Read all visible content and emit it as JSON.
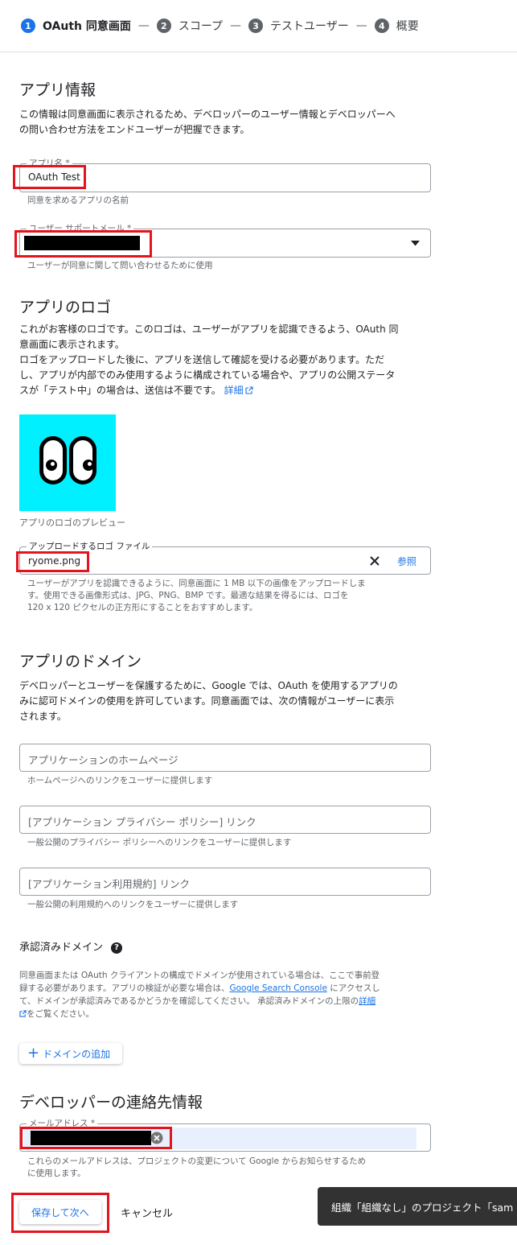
{
  "stepper": {
    "steps": [
      {
        "num": "1",
        "label": "OAuth 同意画面"
      },
      {
        "num": "2",
        "label": "スコープ"
      },
      {
        "num": "3",
        "label": "テストユーザー"
      },
      {
        "num": "4",
        "label": "概要"
      }
    ],
    "separator": "—"
  },
  "app_info": {
    "title": "アプリ情報",
    "description_lines": [
      "この情報は同意画面に表示されるため、デベロッパーのユーザー情報とデベロッパーへ",
      "の問い合わせ方法をエンドユーザーが把握できます。"
    ],
    "app_name": {
      "label": "アプリ名 *",
      "value": "OAuth Test",
      "hint": "同意を求めるアプリの名前"
    },
    "support_email": {
      "label": "ユーザー サポートメール *",
      "hint": "ユーザーが同意に関して問い合わせるために使用"
    }
  },
  "app_logo": {
    "title": "アプリのロゴ",
    "description_lines": [
      "これがお客様のロゴです。このロゴは、ユーザーがアプリを認識できるよう、OAuth 同",
      "意画面に表示されます。",
      "ロゴをアップロードした後に、アプリを送信して確認を受ける必要があります。ただ",
      "し、アプリが内部でのみ使用するように構成されている場合や、アプリの公開ステータ",
      "スが「テスト中」の場合は、送信は不要です。"
    ],
    "details_link": "詳細",
    "preview_caption": "アプリのロゴのプレビュー",
    "file_field": {
      "label": "アップロードするロゴ ファイル",
      "value": "ryome.png",
      "browse_label": "参照"
    },
    "file_hint_lines": [
      "ユーザーがアプリを認識できるように、同意画面に 1 MB 以下の画像をアップロードしま",
      "す。使用できる画像形式は、JPG、PNG、BMP です。最適な結果を得るには、ロゴを",
      "120 x 120 ピクセルの正方形にすることをおすすめします。"
    ]
  },
  "app_domain": {
    "title": "アプリのドメイン",
    "description_lines": [
      "デベロッパーとユーザーを保護するために、Google では、OAuth を使用するアプリの",
      "みに認可ドメインの使用を許可しています。同意画面では、次の情報がユーザーに表示",
      "されます。"
    ],
    "homepage": {
      "placeholder": "アプリケーションのホームページ",
      "hint": "ホームページへのリンクをユーザーに提供します"
    },
    "privacy": {
      "placeholder": "[アプリケーション プライバシー ポリシー] リンク",
      "hint": "一般公開のプライバシー ポリシーへのリンクをユーザーに提供します"
    },
    "terms": {
      "placeholder": "[アプリケーション利用規約] リンク",
      "hint": "一般公開の利用規約へのリンクをユーザーに提供します"
    }
  },
  "authorized_domains": {
    "title": "承認済みドメイン",
    "help_glyph": "?",
    "line1": "同意画面または OAuth クライアントの構成でドメインが使用されている場合は、ここで事前登",
    "line2_pre": "録する必要があります。アプリの検証が必要な場合は、",
    "line2_link": "Google Search Console",
    "line2_post": " にアクセスし",
    "line3_pre": "て、ドメインが承認済みであるかどうかを確認してください。 承認済みドメインの上限の",
    "line3_link": "詳細",
    "line4_post": "をご覧ください。",
    "add_button": "ドメインの追加"
  },
  "developer_contact": {
    "title": "デベロッパーの連絡先情報",
    "email_label": "メールアドレス *",
    "hint_lines": [
      "これらのメールアドレスは、プロジェクトの変更について Google からお知らせするため",
      "に使用します。"
    ]
  },
  "actions": {
    "save": "保存して次へ",
    "cancel": "キャンセル"
  },
  "toast": {
    "text": "組織「組織なし」のプロジェクト「sam"
  },
  "colors": {
    "accent": "#1a73e8",
    "highlight": "#e3141e",
    "logo_bg": "#00f0ff"
  }
}
